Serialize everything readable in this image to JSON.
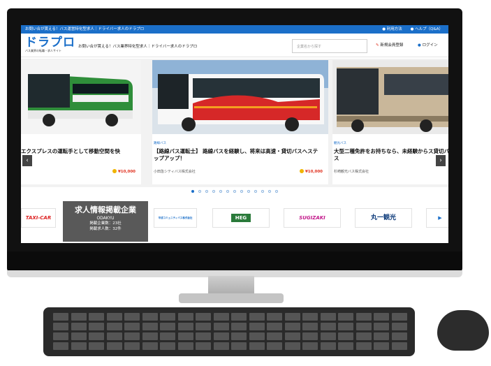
{
  "topbar": {
    "text": "お問い合が貰える！バス運営特化型求人｜ドライバー求人のドラプロ",
    "links": [
      "● 利用方法",
      "● ヘルプ（Q&A）"
    ]
  },
  "header": {
    "logo_text": "ドラプロ",
    "logo_sub": "バス業界の転職・求人サイト",
    "tagline": "お問い合が貰える！バス業界特化型求人｜ドライバー求人のドラプロ",
    "search_placeholder": "企業名から探す",
    "register_label": "新規会員登録",
    "login_label": "ログイン"
  },
  "carousel": {
    "cards": [
      {
        "tag": "",
        "title": "エクスプレスの運転手として移動空間を快",
        "company": "",
        "salary": "¥10,000"
      },
      {
        "tag": "路線バス",
        "title": "【路線バス運転士】 路線バスを経験し、将来は高速・貸切バスへステップアップ！",
        "company": "小田急シティバス株式会社",
        "salary": "¥10,000"
      },
      {
        "tag": "観光バス",
        "title": "大型二種免許をお持ちなら、未経験からス貸切バス",
        "company": "杉崎観光バス株式会社",
        "salary": ""
      }
    ],
    "dots_count": 13,
    "active_dot": 0,
    "prev_icon": "chevron-left-icon",
    "next_icon": "chevron-right-icon"
  },
  "partners": {
    "overlay": {
      "heading": "求人情報掲載企業",
      "brand": "ODAKYU",
      "stat1": "掲載企業数：23社",
      "stat2": "掲載求人数：32件"
    },
    "logos": [
      "TAXI-CAR",
      "平成コミュニティバス株式会社",
      "HEG",
      "SUGIZAKI",
      "丸一観光",
      ""
    ]
  },
  "colors": {
    "brand_blue": "#1b6fc9",
    "accent_red": "#e0301e",
    "gold": "#f0b400"
  }
}
